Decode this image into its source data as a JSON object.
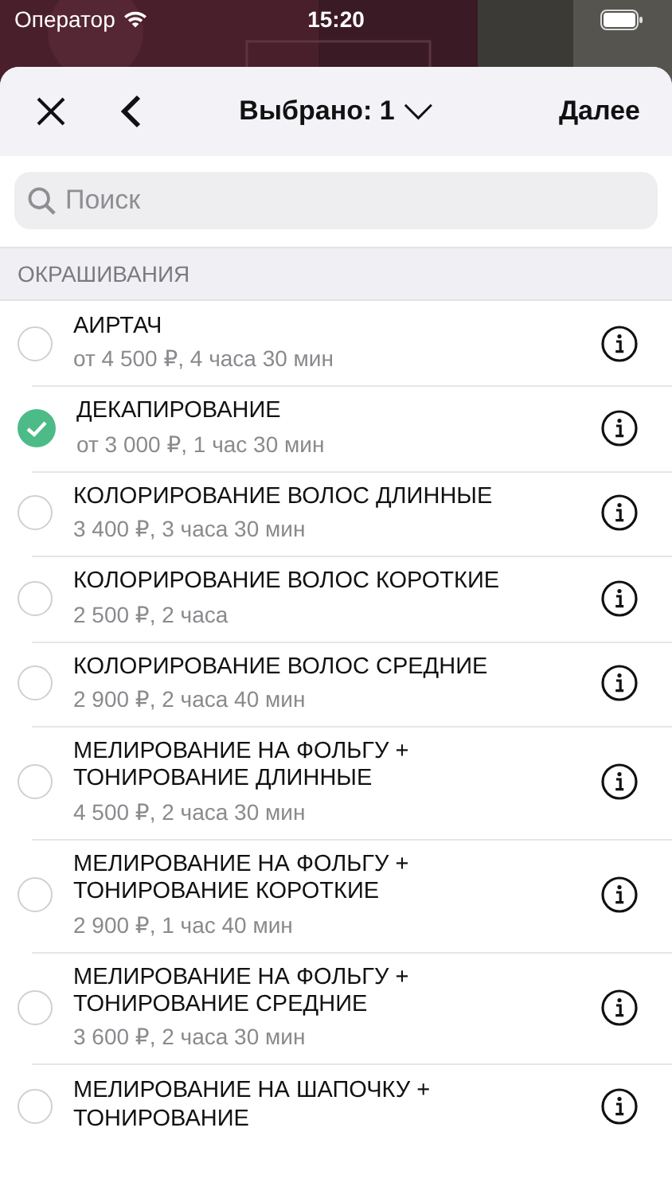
{
  "status_bar": {
    "carrier": "Оператор",
    "time": "15:20"
  },
  "header": {
    "title": "Выбрано: 1",
    "next": "Далее"
  },
  "search": {
    "placeholder": "Поиск"
  },
  "section": {
    "title": "ОКРАШИВАНИЯ"
  },
  "services": [
    {
      "title": "АИРТАЧ",
      "details": "от 4 500 ₽, 4 часа 30 мин",
      "selected": false
    },
    {
      "title": "ДЕКАПИРОВАНИЕ",
      "details": "от 3 000 ₽, 1 час 30 мин",
      "selected": true
    },
    {
      "title": "КОЛОРИРОВАНИЕ ВОЛОС ДЛИННЫЕ",
      "details": "3 400 ₽, 3 часа 30 мин",
      "selected": false
    },
    {
      "title": "КОЛОРИРОВАНИЕ ВОЛОС КОРОТКИЕ",
      "details": "2 500 ₽, 2 часа",
      "selected": false
    },
    {
      "title": "КОЛОРИРОВАНИЕ ВОЛОС СРЕДНИЕ",
      "details": "2 900 ₽, 2 часа 40 мин",
      "selected": false
    },
    {
      "title": "МЕЛИРОВАНИЕ НА ФОЛЬГУ + ТОНИРОВАНИЕ ДЛИННЫЕ",
      "details": "4 500 ₽, 2 часа 30 мин",
      "selected": false
    },
    {
      "title": "МЕЛИРОВАНИЕ НА ФОЛЬГУ + ТОНИРОВАНИЕ КОРОТКИЕ",
      "details": "2 900 ₽, 1 час 40 мин",
      "selected": false
    },
    {
      "title": "МЕЛИРОВАНИЕ НА ФОЛЬГУ + ТОНИРОВАНИЕ СРЕДНИЕ",
      "details": "3 600 ₽, 2 часа 30 мин",
      "selected": false
    },
    {
      "title": "МЕЛИРОВАНИЕ НА ШАПОЧКУ + ТОНИРОВАНИЕ",
      "selected": false
    }
  ]
}
